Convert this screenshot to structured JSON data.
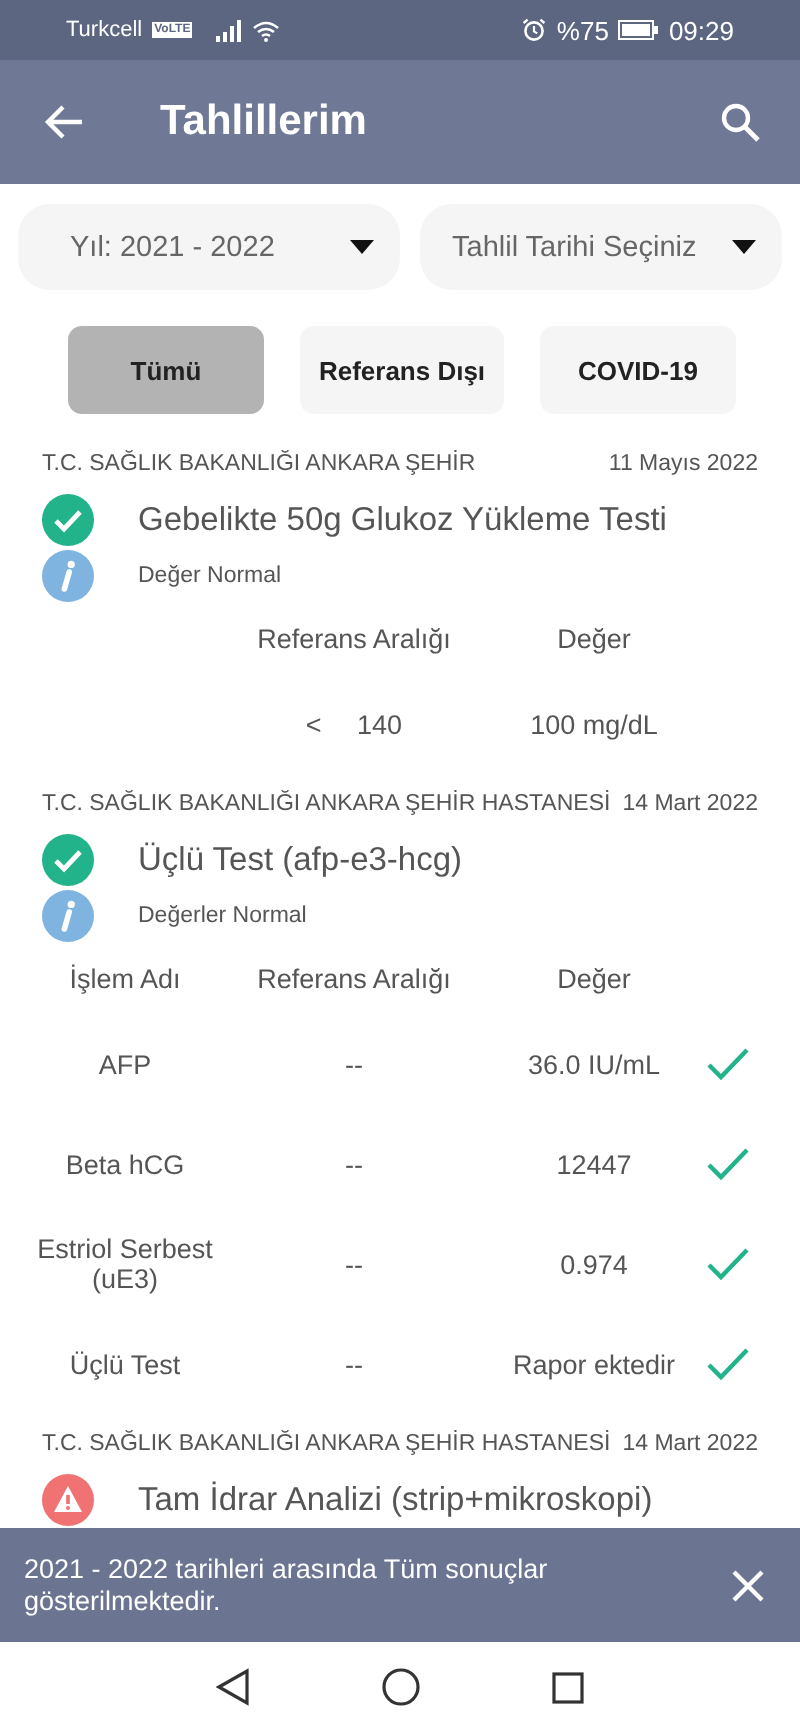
{
  "status_bar": {
    "carrier": "Turkcell",
    "network_badge": "VoLTE",
    "battery": "%75",
    "time": "09:29"
  },
  "app_bar": {
    "title": "Tahlillerim"
  },
  "filters": [
    {
      "kind": "dropdown",
      "label": "Yıl: 2021 - 2022"
    },
    {
      "kind": "dropdown",
      "label": "Tahlil Tarihi Seçiniz"
    }
  ],
  "tabs": [
    {
      "label": "Tümü",
      "selected": true
    },
    {
      "label": "Referans Dışı",
      "selected": false
    },
    {
      "label": "COVID-19",
      "selected": false
    }
  ],
  "results": [
    {
      "hospital": "T.C. SAĞLIK BAKANLIĞI ANKARA ŞEHİR",
      "date": "11 Mayıs 2022",
      "kind": "ok",
      "title": "Gebelikte 50g Glukoz Yükleme Testi",
      "note": "Değer Normal",
      "columns": [
        "",
        "Referans Aralığı",
        "Değer"
      ],
      "rows": [
        {
          "name": "",
          "range": "< 140",
          "value": "100 mg/dL",
          "check": false
        }
      ]
    },
    {
      "hospital": "T.C. SAĞLIK BAKANLIĞI ANKARA ŞEHİR HASTANESİ",
      "date": "14 Mart 2022",
      "kind": "ok",
      "title": "Üçlü Test (afp-e3-hcg)",
      "note": "Değerler Normal",
      "columns": [
        "İşlem Adı",
        "Referans Aralığı",
        "Değer"
      ],
      "rows": [
        {
          "name": "AFP",
          "range": "--",
          "value": "36.0 IU/mL",
          "check": true
        },
        {
          "name": "Beta hCG",
          "range": "--",
          "value": "12447",
          "check": true
        },
        {
          "name": "Estriol Serbest (uE3)",
          "range": "--",
          "value": "0.974",
          "check": true
        },
        {
          "name": "Üçlü Test",
          "range": "--",
          "value": "Rapor ektedir",
          "check": true
        }
      ]
    },
    {
      "hospital": "T.C. SAĞLIK BAKANLIĞI ANKARA ŞEHİR HASTANESİ",
      "date": "14 Mart 2022",
      "kind": "warning",
      "title": "Tam İdrar Analizi (strip+mikroskopi)"
    }
  ],
  "snackbar": {
    "message": "2021 - 2022 tarihleri arasında Tüm sonuçlar gösterilmektedir."
  }
}
